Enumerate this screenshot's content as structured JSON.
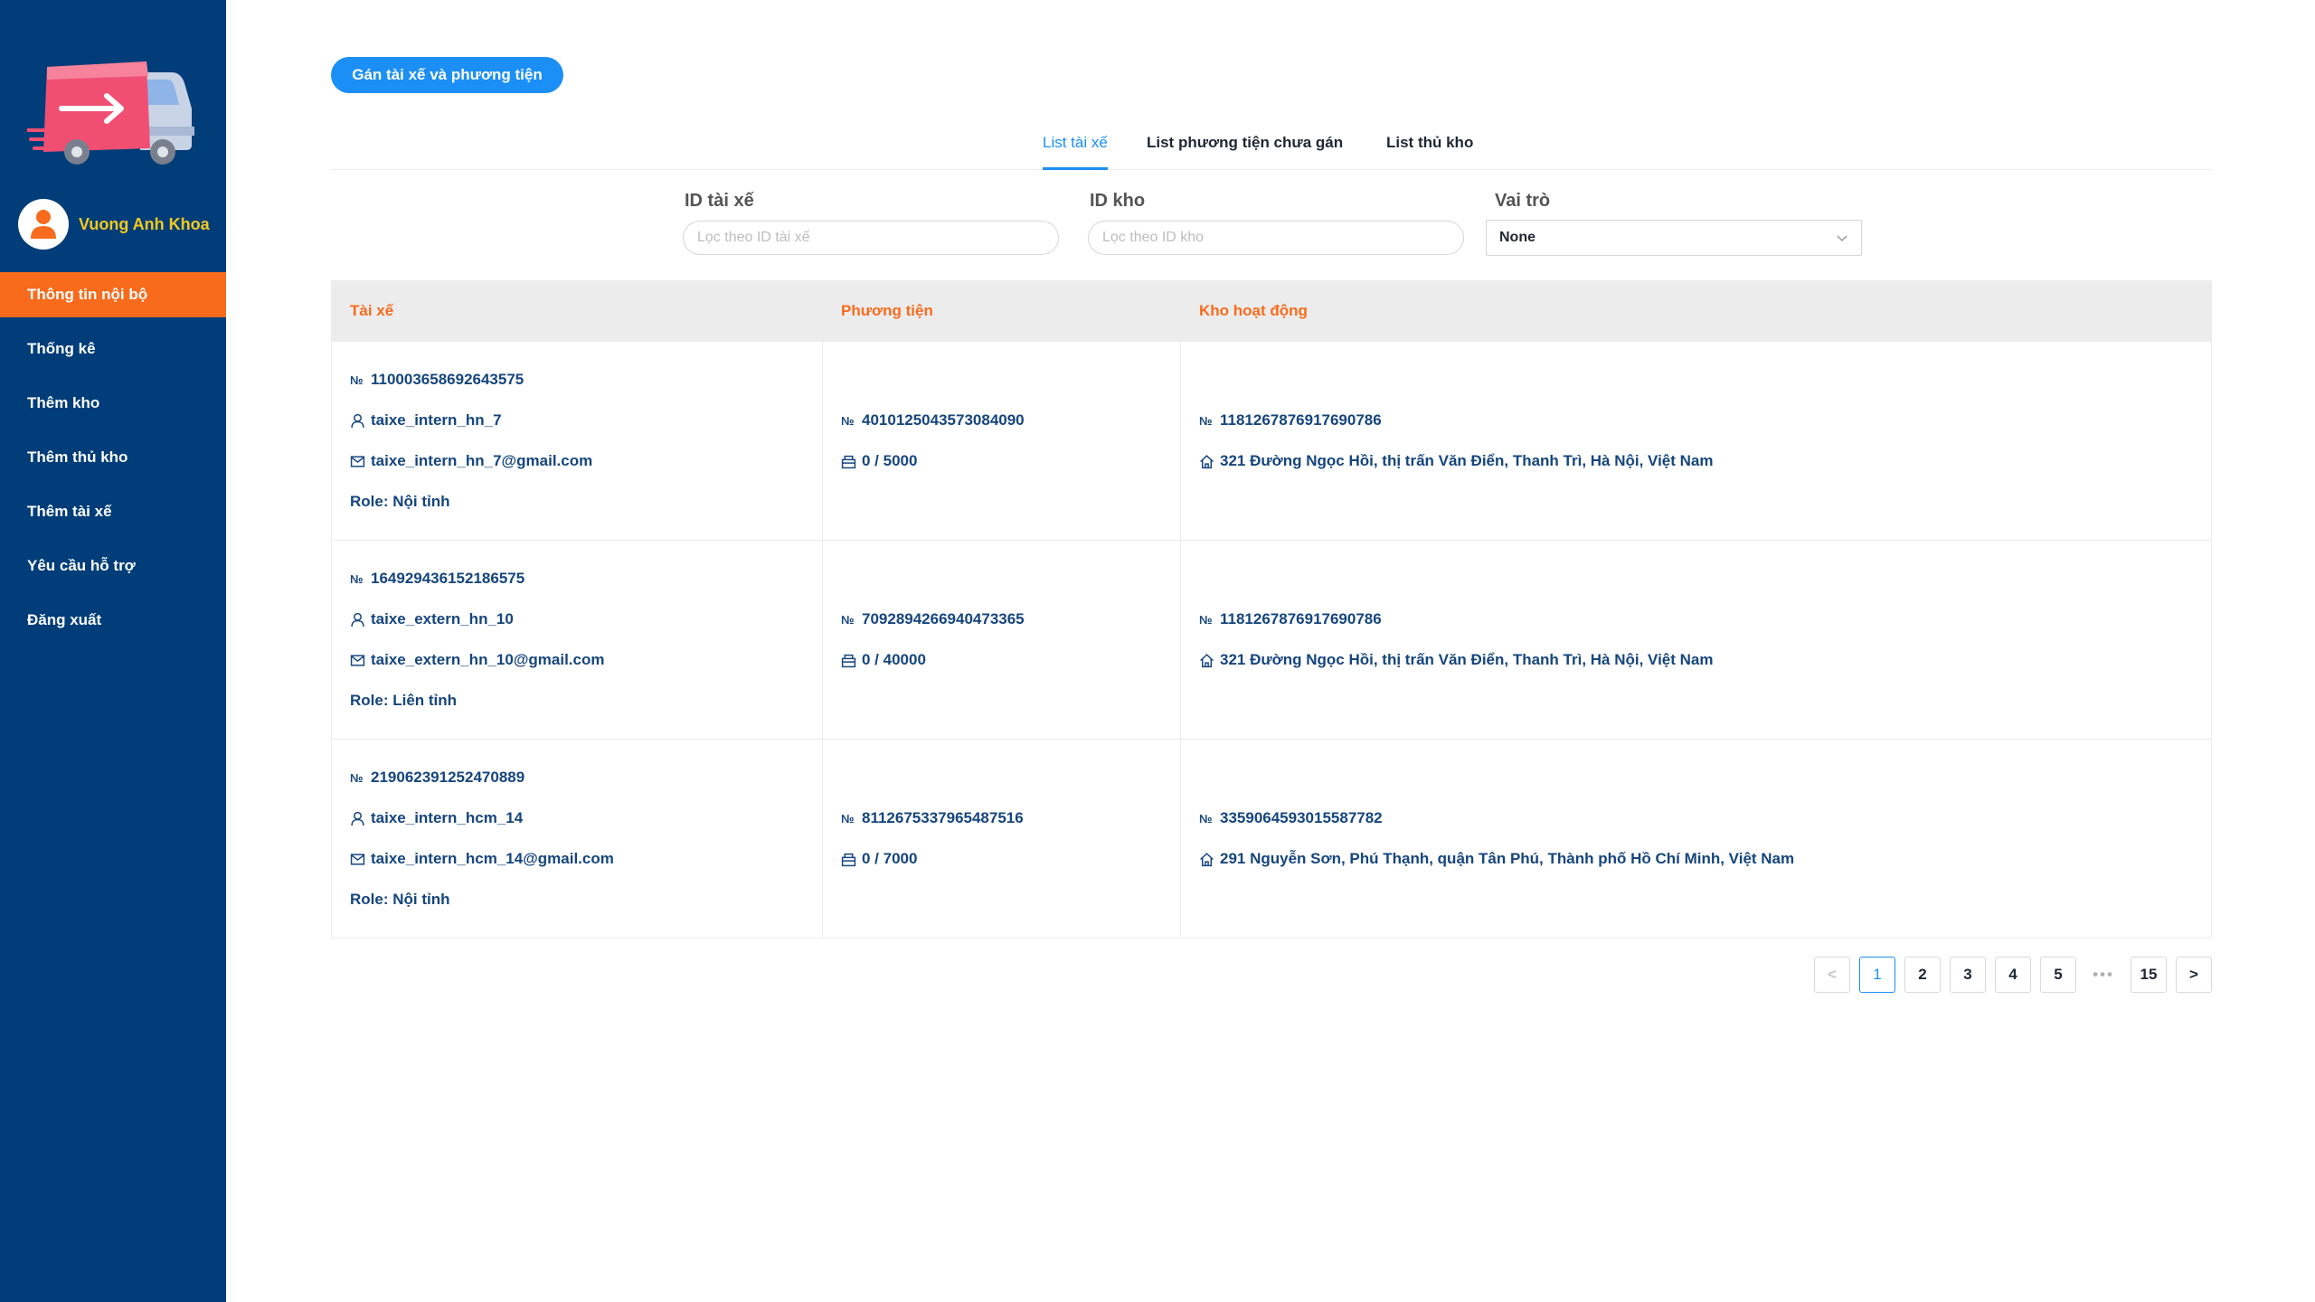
{
  "sidebar": {
    "user_name": "Vuong Anh Khoa",
    "items": [
      {
        "label": "Thông tin nội bộ"
      },
      {
        "label": "Thống kê"
      },
      {
        "label": "Thêm kho"
      },
      {
        "label": "Thêm thủ kho"
      },
      {
        "label": "Thêm tài xế"
      },
      {
        "label": "Yêu cầu hỗ trợ"
      },
      {
        "label": "Đăng xuất"
      }
    ],
    "bg_color": "#003d79",
    "active_color": "#f86b1d"
  },
  "header": {
    "assign_button": "Gán tài xế và phương tiện"
  },
  "tabs": [
    {
      "label": "List tài xế"
    },
    {
      "label": "List phương tiện chưa gán"
    },
    {
      "label": "List thủ kho"
    }
  ],
  "filters": {
    "driver_id_label": "ID tài xế",
    "driver_id_placeholder": "Lọc theo ID tài xế",
    "warehouse_id_label": "ID kho",
    "warehouse_id_placeholder": "Lọc theo ID kho",
    "role_label": "Vai trò",
    "role_value": "None"
  },
  "table": {
    "headers": [
      "Tài xế",
      "Phương tiện",
      "Kho hoạt động"
    ],
    "no_symbol": "№",
    "rows": [
      {
        "driver_id": "1100036586926435​75",
        "username": "taixe_intern_hn_7",
        "email": "taixe_intern_hn_7@gmail.com",
        "role": "Role: Nội tỉnh",
        "vehicle_id": "4010125043573084090",
        "capacity": "0 / 5000",
        "warehouse_id": "1181267876917690786",
        "address": "321 Đường Ngọc Hồi, thị trấn Văn Điển, Thanh Trì, Hà Nội, Việt Nam"
      },
      {
        "driver_id": "1649294361521865​75",
        "username": "taixe_extern_hn_10",
        "email": "taixe_extern_hn_10@gmail.com",
        "role": "Role: Liên tỉnh",
        "vehicle_id": "7092894266940473365",
        "capacity": "0 / 40000",
        "warehouse_id": "1181267876917690786",
        "address": "321 Đường Ngọc Hồi, thị trấn Văn Điển, Thanh Trì, Hà Nội, Việt Nam"
      },
      {
        "driver_id": "219062391252470889",
        "username": "taixe_intern_hcm_14",
        "email": "taixe_intern_hcm_14@gmail.com",
        "role": "Role: Nội tỉnh",
        "vehicle_id": "8112675337965487516",
        "capacity": "0 / 7000",
        "warehouse_id": "3359064593015587782",
        "address": "291 Nguyễn Sơn, Phú Thạnh, quận Tân Phú, Thành phố Hồ Chí Minh, Việt Nam"
      }
    ]
  },
  "pagination": {
    "prev": "<",
    "pages": [
      "1",
      "2",
      "3",
      "4",
      "5"
    ],
    "dots": "•••",
    "last": "15",
    "next": ">",
    "current": "1"
  },
  "colors": {
    "primary": "#1b8ff5",
    "accent": "#f86b1d",
    "text_dark_blue": "#15457e"
  }
}
